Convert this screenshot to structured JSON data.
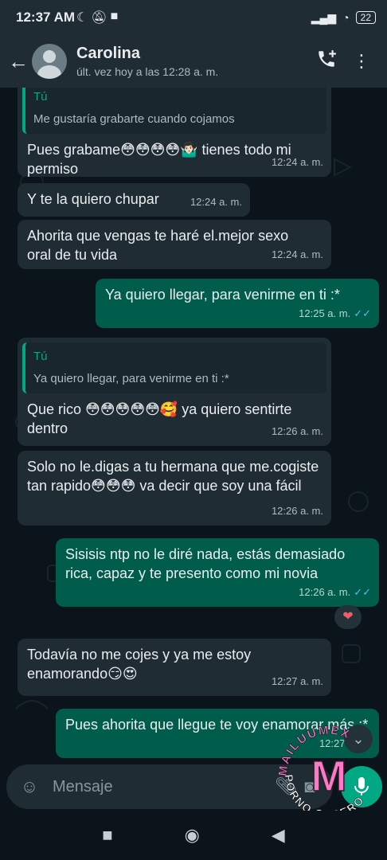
{
  "status_bar": {
    "time": "12:37 AM",
    "battery": "22"
  },
  "header": {
    "contact_name": "Carolina",
    "last_seen": "últ. vez hoy a las 12:28 a. m."
  },
  "messages": [
    {
      "dir": "in",
      "quote_name": "Tú",
      "quote_text": "Me gustaría grabarte cuando cojamos",
      "text": "Pues grabame😳😳😳😳🤷🏻‍♂️ tienes todo mi permiso",
      "time": "12:24 a. m."
    },
    {
      "dir": "in",
      "text": "Y te la quiero chupar",
      "time": "12:24 a. m."
    },
    {
      "dir": "in",
      "text": "Ahorita que vengas te haré el.mejor sexo oral de tu vida",
      "time": "12:24 a. m."
    },
    {
      "dir": "out",
      "text": "Ya quiero llegar, para venirme en ti :*",
      "time": "12:25 a. m."
    },
    {
      "dir": "in",
      "quote_name": "Tú",
      "quote_text": "Ya quiero llegar, para venirme en ti :*",
      "text": "Que rico 😳😳😳😳😳🥰 ya quiero sentirte dentro",
      "time": "12:26 a. m."
    },
    {
      "dir": "in",
      "text": "Solo no le.digas a tu hermana que me.cogiste tan rapido😳😳😳 va decir que soy una fácil",
      "time": "12:26 a. m."
    },
    {
      "dir": "out",
      "text": "Sisisis ntp no le diré nada, estás demasiado rica, capaz y te presento como mi novia",
      "time": "12:26 a. m.",
      "reaction": "❤"
    },
    {
      "dir": "in",
      "text": "Todavía no me cojes y ya me estoy enamorando😏😍",
      "time": "12:27 a. m."
    },
    {
      "dir": "out",
      "text": "Pues ahorita que llegue te voy enamorar más :*",
      "time": "12:27 a. m."
    }
  ],
  "input": {
    "placeholder": "Mensaje"
  },
  "watermark": {
    "top_text": "MAILUUMEX",
    "bottom_text": "PORNO CASERO",
    "letter": "M"
  },
  "colors": {
    "incoming": "#202c33",
    "outgoing": "#005c4b",
    "accent": "#00a884",
    "read_ticks": "#53bdeb"
  },
  "icons": {
    "back": "back-arrow-icon",
    "add_call": "add-call-icon",
    "menu": "more-vert-icon",
    "emoji": "emoji-icon",
    "attach": "paperclip-icon",
    "camera": "camera-icon",
    "mic": "mic-icon"
  }
}
